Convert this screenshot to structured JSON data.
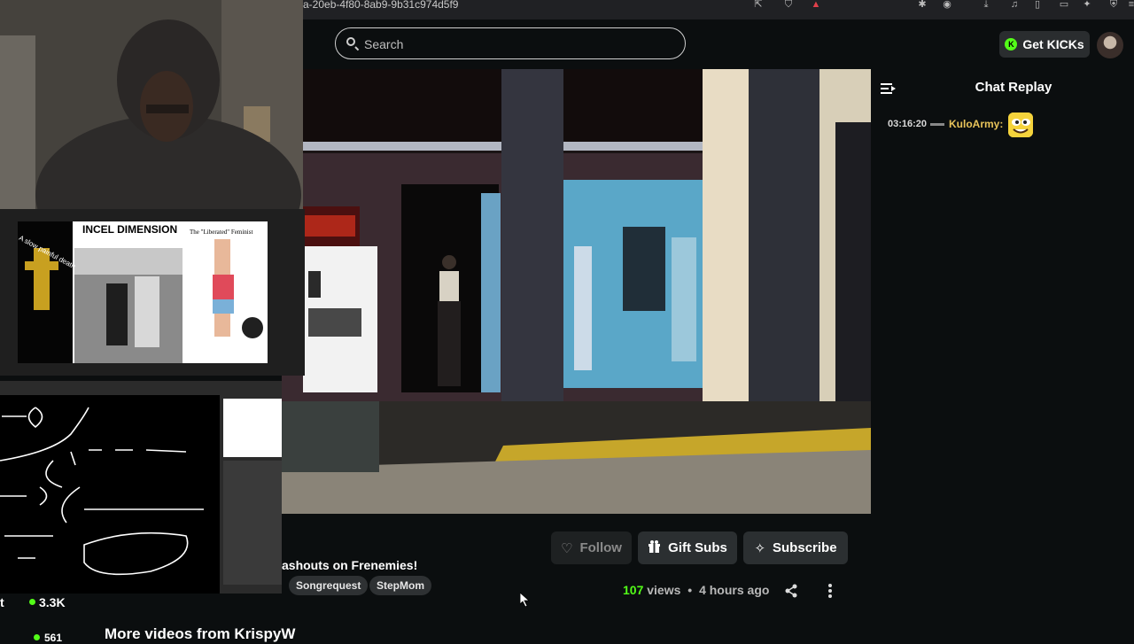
{
  "browser": {
    "url_fragment": "a-20eb-4f80-8ab9-9b31c974d5f9"
  },
  "header": {
    "search_placeholder": "Search",
    "get_kicks_label": "Get KICKs",
    "kick_logo_letter": "K"
  },
  "chat": {
    "title": "Chat Replay",
    "messages": [
      {
        "time": "03:16:20",
        "username": "KuloArmy:"
      }
    ]
  },
  "actions": {
    "follow_label": "Follow",
    "gift_label": "Gift Subs",
    "subscribe_label": "Subscribe"
  },
  "video_info": {
    "title_fragment": "ashouts on Frenemies!",
    "tags": [
      "Songrequest",
      "StepMom"
    ],
    "views_count": "107",
    "views_suffix": "views",
    "separator": "•",
    "time_ago": "4 hours ago"
  },
  "channel": {
    "follower_label_fragment": "t",
    "follower_count": "3.3K",
    "viewer_count_fragment": "561",
    "more_videos_label": "More videos from KrispyW"
  },
  "overlay": {
    "slide_title": "INCEL DIMENSION",
    "slide_subtitle": "The \"Liberated\" Feminist",
    "slide_left_label": "A slow painful death"
  },
  "colors": {
    "accent": "#53fc18",
    "background": "#0b0e0f",
    "button_bg": "#2b2f31",
    "username": "#e8c35a"
  }
}
